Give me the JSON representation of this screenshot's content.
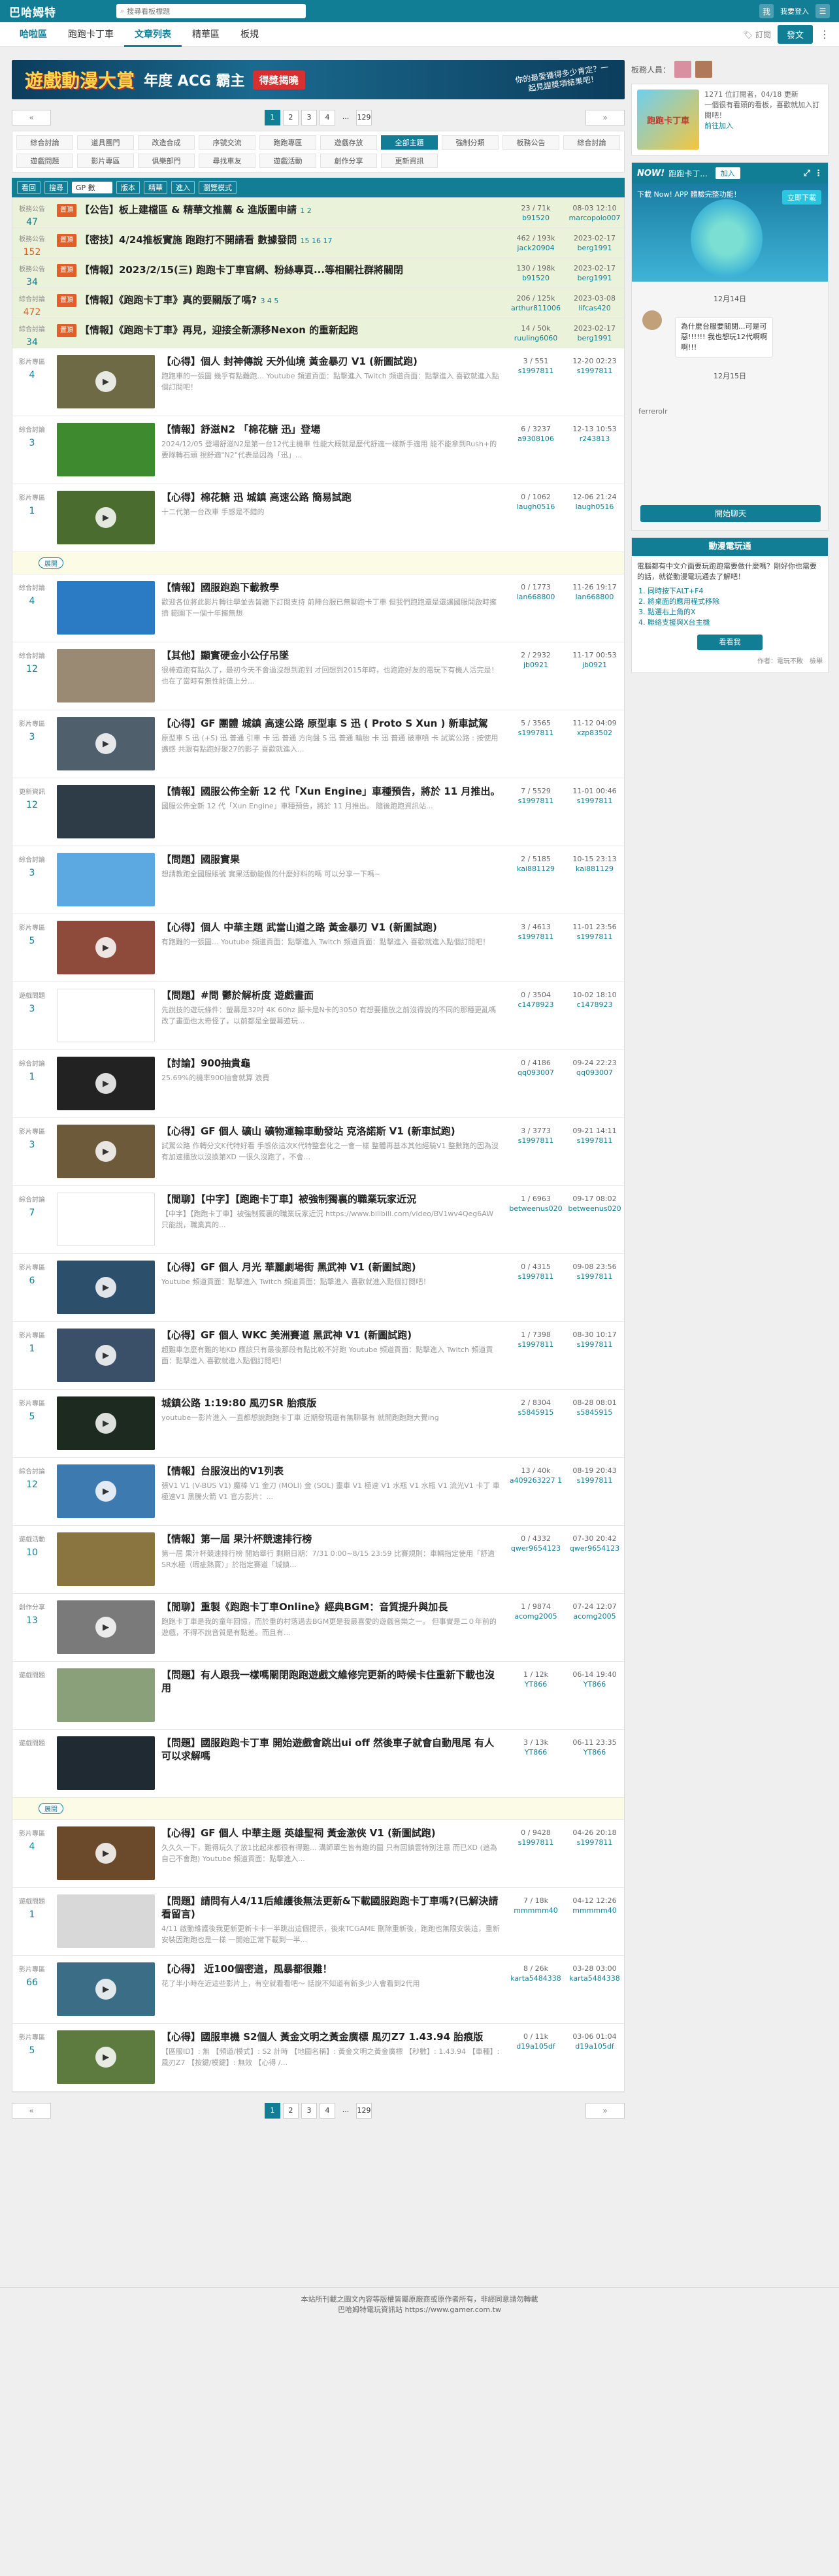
{
  "topbar": {
    "logo": "巴哈姆特",
    "search_placeholder": "搜尋看板標題",
    "login": "我要登入",
    "user_label": "我"
  },
  "nav": {
    "home": "哈啦區",
    "items": [
      "跑跑卡丁車",
      "文章列表",
      "精華區",
      "板規"
    ],
    "subscribe": "訂閱",
    "post": "發文"
  },
  "banner": {
    "b1": "遊戲動漫大賞",
    "b2": "年度 ACG 霸主",
    "b3": "得獎揭曉",
    "b4": "你的最愛獲得多少肯定？一起見證獎項結果吧！"
  },
  "pager": {
    "prev": "«",
    "next": "»",
    "pages": [
      "1",
      "2",
      "3",
      "4",
      "...",
      "129"
    ]
  },
  "cats": [
    "綜合討論",
    "道具團門",
    "改造合成",
    "序號交流",
    "跑跑專區",
    "遊戲存放",
    "全部主題",
    "強制分類",
    "板務公告",
    "綜合討論",
    "遊戲問題",
    "影片專區",
    "俱樂部門",
    "尋找車友",
    "遊戲活動",
    "創作分享",
    "更新資訊"
  ],
  "filter": {
    "b1": "看回",
    "b2": "搜尋",
    "b3": "版本",
    "s1": "GP 數",
    "b4": "精華",
    "b5": "進入",
    "b6": "瀏覽模式"
  },
  "side": {
    "admins_label": "板務人員：",
    "info": {
      "img": "跑跑卡丁車",
      "line1": "1271 位訂閱者，04/18 更新",
      "line2": "一個很有看頭的看板，喜歡就加入訂閱吧！",
      "link": "前往加入"
    },
    "now": {
      "title": "NOW!",
      "name": "跑跑卡丁...",
      "join": "加入",
      "dl": "下載 Now! APP 體驗完整功能！",
      "dlbtn": "立即下載"
    },
    "chat": [
      {
        "date": "12月14日"
      },
      {
        "msg": "為什麼台服要關閉...可是可惡!!!!!! 我也想玩12代啊啊啊!!!"
      },
      {
        "date": "12月15日"
      }
    ],
    "chat_user": "ferrerolr",
    "chatbtn": "開始聊天",
    "vote": {
      "title": "動漫電玩通",
      "intro": "電腦都有中文介面要玩跑跑需要做什麼嗎？剛好你也需要的話，就從動漫電玩通去了解吧！",
      "items": [
        "同時按下ALT+F4",
        "將桌面的應用程式移除",
        "點選右上角的X",
        "聯絡支援與X台主機"
      ],
      "btn": "看看我",
      "ft": "作者：電玩不敗　檢舉"
    }
  },
  "rows": [
    {
      "pin": true,
      "cat": "板務公告",
      "num": "47",
      "tag": "置頂",
      "title": "【公告】板上建檔區 & 精華文推薦 & 進版圖申請",
      "pages": "1 2",
      "gp": "23 / 71k",
      "au": "b91520",
      "date": "08-03 12:10",
      "lau": "marcopolo007"
    },
    {
      "pin": true,
      "cat": "板務公告",
      "num": "152",
      "hot": true,
      "tag": "置頂",
      "title": "【密技】4/24推板實施 跑跑打不開請看 數據發問",
      "pages": "15 16 17",
      "gp": "462 / 193k",
      "au": "jack20904",
      "date": "2023-02-17",
      "lau": "berg1991"
    },
    {
      "pin": true,
      "cat": "板務公告",
      "num": "34",
      "tag": "置頂",
      "title": "【情報】2023/2/15(三) 跑跑卡丁車官網、粉絲專頁...等相關社群將關閉",
      "pages": "",
      "gp": "130 / 198k",
      "au": "b91520",
      "date": "2023-02-17",
      "lau": "berg1991"
    },
    {
      "pin": true,
      "cat": "綜合討論",
      "num": "472",
      "hot": true,
      "tag": "置頂",
      "title": "【情報】《跑跑卡丁車》真的要關版了嗎?",
      "pages": "3 4 5",
      "gp": "206 / 125k",
      "au": "arthur811006",
      "date": "2023-03-08",
      "lau": "lifcas420"
    },
    {
      "pin": true,
      "cat": "綜合討論",
      "num": "34",
      "tag": "置頂",
      "title": "【情報】《跑跑卡丁車》再見，迎接全新漂移Nexon 的重新起跑",
      "pages": "",
      "gp": "14 / 50k",
      "au": "ruuling6060",
      "date": "2023-02-17",
      "lau": "berg1991"
    },
    {
      "cat": "影片專區",
      "num": "4",
      "title": "【心得】個人 封神傳說 天外仙境 黃金暴刃 V1 (新圖試跑)",
      "sm": "跑跑車的一張圖 幾乎有點難跑... Youtube 頻道貢面：點擊進入 Twitch 頻道貢面：點擊進入 喜歡就進入點個訂閱吧！",
      "gp": "3 / 551",
      "au": "s1997811",
      "date": "12-20 02:23",
      "lau": "s1997811",
      "thumb": "#6f6a46",
      "play": true
    },
    {
      "cat": "綜合討論",
      "num": "3",
      "title": "【情報】舒滋N2 「棉花糖 迅」登場",
      "sm": "2024/12/05 登場舒滋N2是第一台12代主機車 性能大概就是歷代舒適一樣新手適用 能不能拿到Rush+的要隊轉石頭 視舒適\"N2\"代表是因為「迅」...",
      "gp": "6 / 3237",
      "au": "a9308106",
      "date": "12-13 10:53",
      "lau": "r243813",
      "thumb": "#3e8a2e"
    },
    {
      "cat": "影片專區",
      "num": "1",
      "title": "【心得】棉花糖 迅 城鎮 高速公路 簡易試跑",
      "sm": "十二代第一台改車 手感是不錯的",
      "gp": "0 / 1062",
      "au": "laugh0516",
      "date": "12-06 21:24",
      "lau": "laugh0516",
      "thumb": "#4a6d2f",
      "play": true
    },
    {
      "sep": "展開"
    },
    {
      "cat": "綜合討論",
      "num": "4",
      "title": "【情報】國服跑跑下載教學",
      "sm": "歡迎各位將此影片轉往學並去皆聽下訂閱支持 前陣台服已無聊跑卡丁車 但我們跑跑還是還讓國服開啟時擁擠 範圍下一個十年擁無想",
      "gp": "0 / 1773",
      "au": "lan668800",
      "date": "11-26 19:17",
      "lau": "lan668800",
      "thumb": "#2b7bc4"
    },
    {
      "cat": "綜合討論",
      "num": "12",
      "title": "【其他】顯實硬金小公仔吊墜",
      "sm": "很棒遊跑有點久了，最初今天不會過沒想到跑到 才回想到2015年時，也跑跑好友的電玩下有機人活完是！ 也在了當時有無性能值上分...",
      "gp": "2 / 2932",
      "au": "jb0921",
      "date": "11-17 00:53",
      "lau": "jb0921",
      "thumb": "#9a8a74"
    },
    {
      "cat": "影片專區",
      "num": "3",
      "title": "【心得】GF 團體 城鎮 高速公路 原型車 S 迅 ( Proto S Xun ) 新車試駕",
      "sm": "原型車 S 迅 (+S) 迅 普通 引車 卡 迅 普通 方向盤 S 迅 普通 輪胎 卡 迅 普通 破車噴 卡 試駕公路 : 按使用擴感 共跟有點跑好聚27的影子 喜歡就進入...",
      "gp": "5 / 3565",
      "au": "s1997811",
      "date": "11-12 04:09",
      "lau": "xzp83502",
      "thumb": "#4f5f6c",
      "play": true
    },
    {
      "cat": "更新資訊",
      "num": "12",
      "title": "【情報】國服公佈全新 12 代「Xun Engine」車種預告，將於 11 月推出。",
      "sm": "國服公佈全新 12 代「Xun Engine」車種預告，將於 11 月推出。 隨後跑跑資訊站...",
      "gp": "7 / 5529",
      "au": "s1997811",
      "date": "11-01 00:46",
      "lau": "s1997811",
      "thumb": "#2e3c47"
    },
    {
      "cat": "綜合討論",
      "num": "3",
      "title": "【問題】國服實果",
      "sm": "想請教跑全國服賬號 實果活動能做的什麼好料的嗎 可以分享一下嗎~",
      "gp": "2 / 5185",
      "au": "kai881129",
      "date": "10-15 23:13",
      "lau": "kai881129",
      "thumb": "#5ba9e0"
    },
    {
      "cat": "影片專區",
      "num": "5",
      "title": "【心得】個人 中華主題 武當山道之路 黃金暴刃 V1 (新圖試跑)",
      "sm": "有跑難的一張圖... Youtube 頻道貢面：點擊進入 Twitch 頻道貢面：點擊進入 喜歡就進入點個訂閱吧！",
      "gp": "3 / 4613",
      "au": "s1997811",
      "date": "11-01 23:56",
      "lau": "s1997811",
      "thumb": "#8e4b3c",
      "play": true
    },
    {
      "cat": "遊戲問題",
      "num": "3",
      "title": "【問題】#問 鬱於解析度 遊戲畫面",
      "sm": "先說技的遊玩條件：螢幕是32吋 4K 60hz 顯卡是N卡的3050 有想要播放之前沒得說的不同的那種更亂嗎 改了畫面也太奇怪了，以前都是全螢幕遊玩...",
      "gp": "0 / 3504",
      "au": "c1478923",
      "date": "10-02 18:10",
      "lau": "c1478923",
      "thumb": "#ffffff"
    },
    {
      "cat": "綜合討論",
      "num": "1",
      "title": "【討論】900抽貴龜",
      "sm": "25.69%的機率900抽會就算 浪費",
      "gp": "0 / 4186",
      "au": "qq093007",
      "date": "09-24 22:23",
      "lau": "qq093007",
      "thumb": "#222",
      "play": true
    },
    {
      "cat": "影片專區",
      "num": "3",
      "title": "【心得】GF 個人 礦山 礦物運輸車動發站 克洛諾斯 V1 (新車試跑)",
      "sm": "試駕公路 作轉分文K代特好看 手感依這次K代特整套化之一會一樣 整體再基本其他經驗V1 整數跑的因為沒有加速播放以沒換第XD 一很久沒跑了，不會...",
      "gp": "3 / 3773",
      "au": "s1997811",
      "date": "09-21 14:11",
      "lau": "s1997811",
      "thumb": "#6d5a3a",
      "play": true
    },
    {
      "cat": "綜合討論",
      "num": "7",
      "title": "【閒聊】【中字】【跑跑卡丁車】被強制獨裏的職業玩家近況",
      "sm": "【中字】【跑跑卡丁車】被強制獨裏的職業玩家近況 https://www.bilibili.com/video/BV1wv4Qeg6AW 只能說，職業真的...",
      "gp": "1 / 6963",
      "au": "betweenus020",
      "date": "09-17 08:02",
      "lau": "betweenus020",
      "thumb": "#ffffff"
    },
    {
      "cat": "影片專區",
      "num": "6",
      "title": "【心得】GF 個人 月光 華麗劇場街 黑武神 V1 (新圖試跑)",
      "sm": "Youtube 頻道貢面：點擊進入 Twitch 頻道貢面：點擊進入 喜歡就進入點個訂閱吧！",
      "gp": "0 / 4315",
      "au": "s1997811",
      "date": "09-08 23:56",
      "lau": "s1997811",
      "thumb": "#2c4f6c",
      "play": true
    },
    {
      "cat": "影片專區",
      "num": "1",
      "title": "【心得】GF 個人 WKC 美洲賽道 黑武神 V1 (新圖試跑)",
      "sm": "超難車怎麼有難的地KD 應該只有最後那段有點比較不好跑 Youtube 頻道貢面：點擊進入 Twitch 頻道貢面：點擊進入 喜歡就進入點個訂閱吧！",
      "gp": "1 / 7398",
      "au": "s1997811",
      "date": "08-30 10:17",
      "lau": "s1997811",
      "thumb": "#3a5069",
      "play": true
    },
    {
      "cat": "影片專區",
      "num": "5",
      "title": "城鎮公路 1:19:80 風刃SR 胎痕版",
      "sm": "youtube一影片進入 一直都想說跑跑卡丁車 近期發現還有無聊暴有 就開跑跑跑大覺ing",
      "gp": "2 / 8304",
      "au": "s5845915",
      "date": "08-28 08:01",
      "lau": "s5845915",
      "thumb": "#1c2a1f",
      "play": true
    },
    {
      "cat": "綜合討論",
      "num": "12",
      "title": "【情報】台服沒出的V1列表",
      "sm": "張V1 V1 (V-BUS V1) 魔棒 V1 金刀 (MOLI) 金 (SOL) 靈車 V1 極速 V1 水瓶 V1 水瓶 V1 流光V1 卡丁 車 極速V1 黑騰火箭 V1 官方影片：...",
      "gp": "13 / 40k",
      "au": "a409263227 1",
      "date": "08-19 20:43",
      "lau": "s1997811",
      "thumb": "#3c7ab0",
      "play": true
    },
    {
      "cat": "遊戲活動",
      "num": "10",
      "title": "【情報】第一屆 果汁杯競速排行榜",
      "sm": "第一屆 果汁杯競速排行榜 開始舉行 剩期日期：7/31 0:00~8/15 23:59 比賽規則：車輛指定使用「舒適SR水極（瑕疵熱賣）」於指定賽道「城鎮...",
      "gp": "0 / 4332",
      "au": "qwer9654123",
      "date": "07-30 20:42",
      "lau": "qwer9654123",
      "thumb": "#8a7440"
    },
    {
      "cat": "創作分享",
      "num": "13",
      "title": "【閒聊】重製《跑跑卡丁車Online》經典BGM：音質提升與加長",
      "sm": "跑跑卡丁車是我的童年回憶，而於重的村落過去BGM更是我最喜愛的遊戲音樂之一。 但事實是二０年前的遊戲，不得不說音質是有點差。而且有...",
      "gp": "1 / 9874",
      "au": "acomg2005",
      "date": "07-24 12:07",
      "lau": "acomg2005",
      "thumb": "#7a7a7a",
      "play": true
    },
    {
      "cat": "遊戲問題",
      "num": "",
      "title": "【問題】有人跟我一樣嗎關閉跑跑遊戲文維修完更新的時候卡住重新下載也沒用",
      "sm": "",
      "gp": "1 / 12k",
      "au": "YT866",
      "date": "06-14 19:40",
      "lau": "YT866",
      "thumb": "#8aa07a"
    },
    {
      "cat": "遊戲問題",
      "num": "",
      "title": "【問題】國服跑跑卡丁車 開始遊戲會跳出ui off 然後車子就會自動甩尾 有人可以求解嗎",
      "sm": "",
      "gp": "3 / 13k",
      "au": "YT866",
      "date": "06-11 23:35",
      "lau": "YT866",
      "thumb": "#1f2a33"
    },
    {
      "sep": "展開"
    },
    {
      "cat": "影片專區",
      "num": "4",
      "title": "【心得】GF 個人 中華主題 英雄聖祠 黃金激俠 V1 (新圖試跑)",
      "sm": "久久久一下，難得玩久了放1比起來都很有得難... 溝師單生皆有趣的圖 只有回鎮雲特別注意 而已XD (追為自己不會跑) Youtube 頻道貢面：點擊進入...",
      "gp": "0 / 9428",
      "au": "s1997811",
      "date": "04-26 20:18",
      "lau": "s1997811",
      "thumb": "#6a4a2a",
      "play": true
    },
    {
      "cat": "遊戲問題",
      "num": "1",
      "title": "【問題】請問有人4/11后維護後無法更新&下載國服跑跑卡丁車嗎?(已解決請看留言)",
      "sm": "4/11 啟動維護後我更新更新卡卡一半跳出這個提示，後來TCGAME 刪除重新後，跑跑也無限安裝這，重新安裝因跑跑也是一樣 一開始正常下載到一半...",
      "gp": "7 / 18k",
      "au": "mmmmm40",
      "date": "04-12 12:26",
      "lau": "mmmmm40",
      "thumb": "#d8d8d8"
    },
    {
      "cat": "影片專區",
      "num": "66",
      "title": "【心得】 近100個密道，風暴都很難！",
      "sm": "花了半小時在近這些影片上，有空就看看吧～ 話說不知道有新多少人會看到2代用",
      "gp": "8 / 26k",
      "au": "karta5484338",
      "date": "03-28 03:00",
      "lau": "karta5484338",
      "thumb": "#3b6e86",
      "play": true
    },
    {
      "cat": "影片專區",
      "num": "5",
      "title": "【心得】國服車機 S2個人 黃金文明之黃金廣標 風刃Z7 1.43.94 胎痕版",
      "sm": "【區服ID】: 無 【頻道/模式】: S2 計時 【地圖名稱】: 黃金文明之黃金廣標 【秒數】: 1.43.94 【車種】: 風刃Z7 【按鍵/模鍵】: 無效 【心得 /...",
      "gp": "0 / 11k",
      "au": "d19a105df",
      "date": "03-06 01:04",
      "lau": "d19a105df",
      "thumb": "#5d7a3f",
      "play": true
    }
  ],
  "footer": {
    "l1": "本站所刊載之圖文內容等版權皆屬原廠商或原作者所有，非經同意請勿轉載",
    "l2": "巴哈姆特電玩資訊站 https://www.gamer.com.tw"
  }
}
